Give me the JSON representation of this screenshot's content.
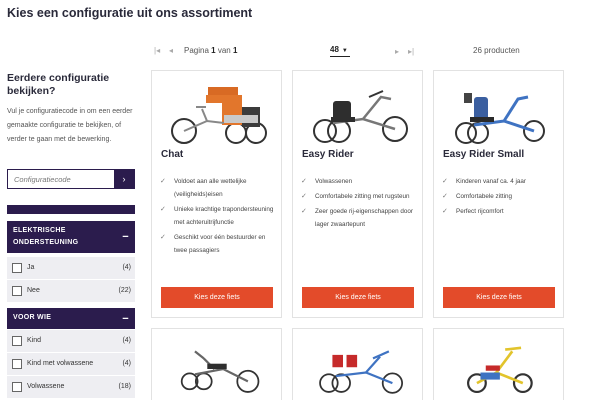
{
  "page_title": "Kies een configuratie uit ons assortiment",
  "pager": {
    "first_icon": "first-page-icon",
    "prev_icon": "prev-page-icon",
    "next_icon": "next-page-icon",
    "last_icon": "last-page-icon",
    "label_page": "Pagina",
    "current_page": "1",
    "label_of": "van",
    "total_pages": "1",
    "per_page": "48",
    "product_count": "26 producten"
  },
  "sidebar": {
    "heading": "Eerdere configuratie bekijken?",
    "text": "Vul je configuratiecode in om een eerder gemaakte configuratie te bekijken, of verder te gaan met de bewerking.",
    "code_placeholder": "Configuratiecode",
    "code_submit_icon": "chevron-right-icon",
    "filters": [
      {
        "title": "ELEKTRISCHE ONDERSTEUNING",
        "options": [
          {
            "label": "Ja",
            "count": "(4)"
          },
          {
            "label": "Nee",
            "count": "(22)"
          }
        ]
      },
      {
        "title": "VOOR WIE",
        "options": [
          {
            "label": "Kind",
            "count": "(4)"
          },
          {
            "label": "Kind met volwassene",
            "count": "(4)"
          },
          {
            "label": "Volwassene",
            "count": "(18)"
          }
        ]
      }
    ]
  },
  "products": [
    {
      "name": "Chat",
      "features": [
        "Voldoet aan alle wettelijke (veiligheids)eisen",
        "Unieke krachtige trapondersteuning met achteruitrijfunctie",
        "Geschikt voor één bestuurder en twee passagiers"
      ],
      "button": "Kies deze fiets"
    },
    {
      "name": "Easy Rider",
      "features": [
        "Volwassenen",
        "Comfortabele zitting met rugsteun",
        "Zeer goede rij-eigenschappen door lager zwaartepunt"
      ],
      "button": "Kies deze fiets"
    },
    {
      "name": "Easy Rider Small",
      "features": [
        "Kinderen vanaf ca. 4 jaar",
        "Comfortabele zitting",
        "Perfect rijcomfort"
      ],
      "button": "Kies deze fiets"
    }
  ],
  "colors": {
    "navy": "#2b1c4d",
    "accent": "#e34b2a"
  }
}
